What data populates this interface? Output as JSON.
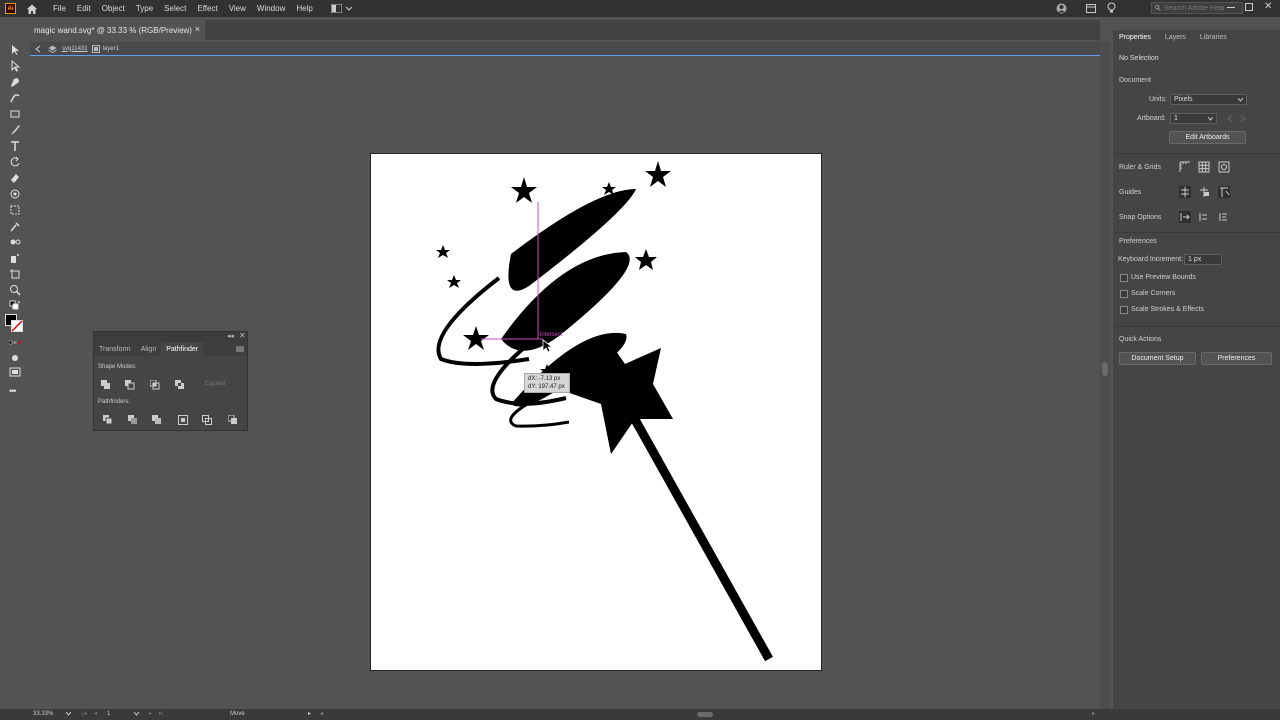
{
  "app": {
    "logo": "Ai",
    "accent": "#ff9a00"
  },
  "menu": [
    "File",
    "Edit",
    "Object",
    "Type",
    "Select",
    "Effect",
    "View",
    "Window",
    "Help"
  ],
  "search": {
    "placeholder": "Search Adobe Help"
  },
  "document": {
    "tab_title": "magic wand.svg* @ 33.33 % (RGB/Preview)",
    "close": "×"
  },
  "isolation": {
    "path_item": "svg11431",
    "layer_item": "layer1"
  },
  "pathfinder_panel": {
    "tabs": [
      "Transform",
      "Align",
      "Pathfinder"
    ],
    "shape_modes_label": "Shape Modes:",
    "expand_label": "Expand",
    "pathfinders_label": "Pathfinders:"
  },
  "properties_panel": {
    "tabs": [
      "Properties",
      "Layers",
      "Libraries"
    ],
    "no_selection": "No Selection",
    "document_label": "Document",
    "units_label": "Units:",
    "units_value": "Pixels",
    "artboard_label": "Artboard:",
    "artboard_value": "1",
    "edit_artboards": "Edit Artboards",
    "rulers_grids": "Ruler & Grids",
    "guides": "Guides",
    "snap_options": "Snap Options",
    "preferences_label": "Preferences",
    "keyboard_increment_label": "Keyboard Increment:",
    "keyboard_increment_value": "1 px",
    "checkboxes": [
      "Use Preview Bounds",
      "Scale Corners",
      "Scale Strokes & Effects"
    ],
    "quick_actions": "Quick Actions",
    "document_setup": "Document Setup",
    "preferences_button": "Preferences"
  },
  "canvas": {
    "smart_guide_label": "intersect",
    "tooltip_dx": "dX: -7.13 px",
    "tooltip_dy": "dY: 197.47 px"
  },
  "status": {
    "zoom": "33.33%",
    "artboard": "1",
    "tool": "Move"
  }
}
